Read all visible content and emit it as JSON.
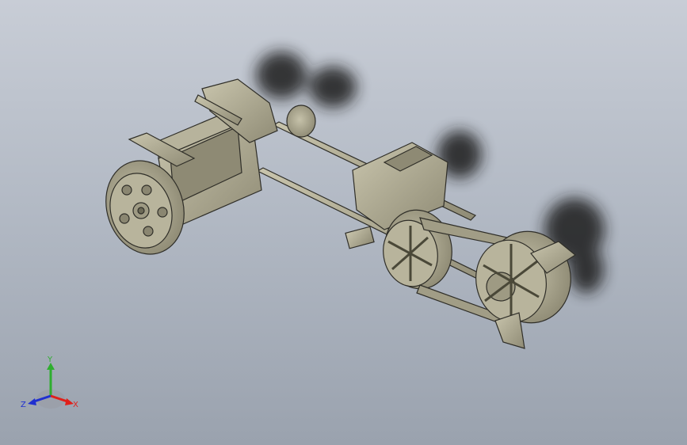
{
  "viewport": {
    "background_top": "#c8cdd6",
    "background_bottom": "#9aa2ae",
    "model_color": "#a9a58e",
    "model_edge_color": "#2f2e28",
    "shadow_color": "#1a1a1a"
  },
  "triad": {
    "x_label": "X",
    "y_label": "Y",
    "z_label": "Z",
    "x_color": "#e0201a",
    "y_color": "#2fae2f",
    "z_color": "#2030d0"
  }
}
